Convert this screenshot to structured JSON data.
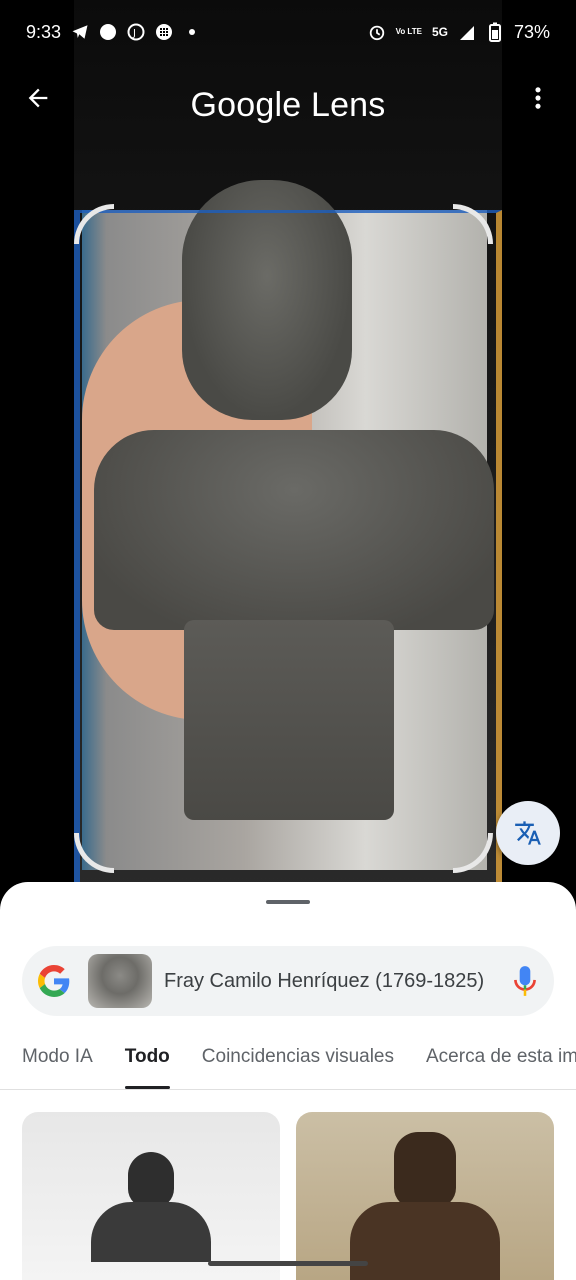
{
  "status": {
    "time": "9:33",
    "network": "5G",
    "volte": "Vo LTE",
    "battery": "73%"
  },
  "header": {
    "title": "Google Lens"
  },
  "search": {
    "query": "Fray Camilo Henríquez (1769-1825)"
  },
  "tabs": [
    {
      "label": "Modo IA"
    },
    {
      "label": "Todo"
    },
    {
      "label": "Coincidencias visuales"
    },
    {
      "label": "Acerca de esta im"
    }
  ],
  "colors": {
    "accent": "#202124",
    "google_blue": "#4285F4",
    "google_red": "#EA4335",
    "google_yellow": "#FBBC05",
    "google_green": "#34A853"
  },
  "icons": {
    "back": "arrow-left-icon",
    "menu": "more-vert-icon",
    "translate": "translate-icon",
    "mic": "mic-icon"
  }
}
